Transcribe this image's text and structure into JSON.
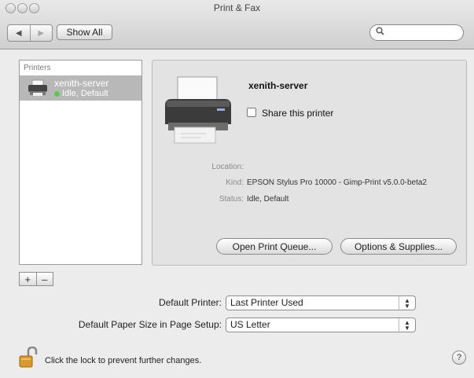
{
  "window": {
    "title": "Print & Fax"
  },
  "toolbar": {
    "back_icon": "back-arrow",
    "forward_icon": "forward-arrow",
    "show_all_label": "Show All",
    "search_placeholder": "",
    "search_value": ""
  },
  "sidebar": {
    "header": "Printers",
    "items": [
      {
        "name": "xenith-server",
        "status": "Idle, Default",
        "status_color": "#5cc94a"
      }
    ],
    "add_label": "+",
    "remove_label": "–"
  },
  "detail": {
    "printer_name": "xenith-server",
    "share_label": "Share this printer",
    "share_checked": false,
    "fields": [
      {
        "label": "Location:",
        "value": ""
      },
      {
        "label": "Kind:",
        "value": "EPSON Stylus Pro 10000 - Gimp-Print v5.0.0-beta2"
      },
      {
        "label": "Status:",
        "value": "Idle, Default"
      }
    ],
    "open_queue_label": "Open Print Queue...",
    "options_label": "Options & Supplies..."
  },
  "defaults": {
    "default_printer_label": "Default Printer:",
    "default_printer_value": "Last Printer Used",
    "paper_size_label": "Default Paper Size in Page Setup:",
    "paper_size_value": "US Letter"
  },
  "lock": {
    "message": "Click the lock to prevent further changes.",
    "icon": "lock-icon"
  },
  "help": {
    "label": "?"
  }
}
